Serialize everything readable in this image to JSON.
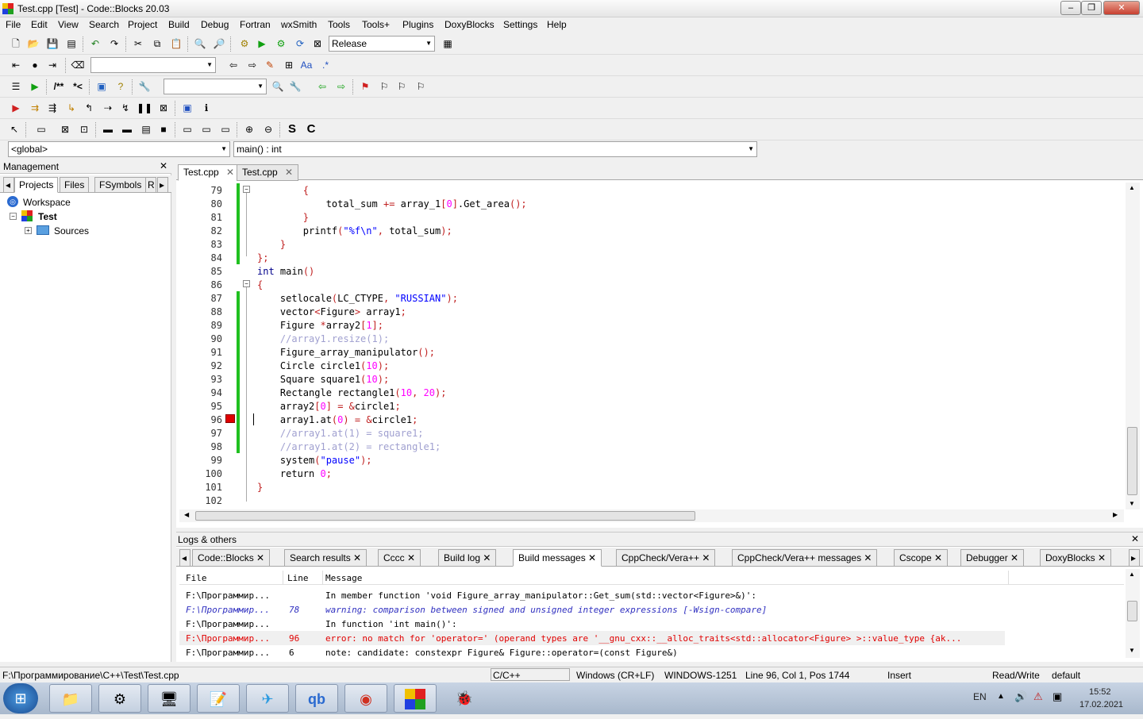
{
  "window": {
    "title": "Test.cpp [Test] - Code::Blocks 20.03"
  },
  "menu": [
    "File",
    "Edit",
    "View",
    "Search",
    "Project",
    "Build",
    "Debug",
    "Fortran",
    "wxSmith",
    "Tools",
    "Tools+",
    "Plugins",
    "DoxyBlocks",
    "Settings",
    "Help"
  ],
  "toolbar": {
    "build_target": "Release"
  },
  "scope": {
    "global": "<global>",
    "function": "main() : int"
  },
  "management": {
    "title": "Management",
    "tabs": [
      "Projects",
      "Files",
      "FSymbols",
      "R"
    ],
    "workspace": "Workspace",
    "project": "Test",
    "folder": "Sources"
  },
  "editor": {
    "tabs": [
      "Test.cpp",
      "Test.cpp"
    ],
    "lines": [
      {
        "n": "79",
        "t": "        {"
      },
      {
        "n": "80",
        "t": "            total_sum += array_1[0].Get_area();"
      },
      {
        "n": "81",
        "t": "        }"
      },
      {
        "n": "82",
        "t": "        printf(\"%f\\n\", total_sum);"
      },
      {
        "n": "83",
        "t": "    }"
      },
      {
        "n": "84",
        "t": "};"
      },
      {
        "n": "85",
        "t": "int main()"
      },
      {
        "n": "86",
        "t": "{"
      },
      {
        "n": "87",
        "t": "    setlocale(LC_CTYPE, \"RUSSIAN\");"
      },
      {
        "n": "88",
        "t": "    vector<Figure> array1;"
      },
      {
        "n": "89",
        "t": "    Figure *array2[1];"
      },
      {
        "n": "90",
        "t": "    //array1.resize(1);"
      },
      {
        "n": "91",
        "t": "    Figure_array_manipulator();"
      },
      {
        "n": "92",
        "t": "    Circle circle1(10);"
      },
      {
        "n": "93",
        "t": "    Square square1(10);"
      },
      {
        "n": "94",
        "t": "    Rectangle rectangle1(10, 20);"
      },
      {
        "n": "95",
        "t": "    array2[0] = &circle1;"
      },
      {
        "n": "96",
        "t": "    array1.at(0) = &circle1;"
      },
      {
        "n": "97",
        "t": "    //array1.at(1) = square1;"
      },
      {
        "n": "98",
        "t": "    //array1.at(2) = rectangle1;"
      },
      {
        "n": "99",
        "t": "    system(\"pause\");"
      },
      {
        "n": "100",
        "t": "    return 0;"
      },
      {
        "n": "101",
        "t": "}"
      },
      {
        "n": "102",
        "t": ""
      }
    ]
  },
  "logs": {
    "title": "Logs & others",
    "tabs": [
      "Code::Blocks",
      "Search results",
      "Cccc",
      "Build log",
      "Build messages",
      "CppCheck/Vera++",
      "CppCheck/Vera++ messages",
      "Cscope",
      "Debugger",
      "DoxyBlocks"
    ],
    "columns": [
      "File",
      "Line",
      "Message"
    ],
    "rows": [
      {
        "file": "F:\\Программир...",
        "line": "",
        "msg": "In member function 'void Figure_array_manipulator::Get_sum(std::vector<Figure>&)':",
        "kind": "normal"
      },
      {
        "file": "F:\\Программир...",
        "line": "78",
        "msg": "warning: comparison between signed and unsigned integer expressions [-Wsign-compare]",
        "kind": "warning"
      },
      {
        "file": "F:\\Программир...",
        "line": "",
        "msg": "In function 'int main()':",
        "kind": "normal"
      },
      {
        "file": "F:\\Программир...",
        "line": "96",
        "msg": "error: no match for 'operator=' (operand types are '__gnu_cxx::__alloc_traits<std::allocator<Figure> >::value_type {ak...",
        "kind": "error"
      },
      {
        "file": "F:\\Программир...",
        "line": "6",
        "msg": "note: candidate: constexpr Figure& Figure::operator=(const Figure&)",
        "kind": "normal"
      }
    ]
  },
  "status": {
    "path": "F:\\Программирование\\C++\\Test\\Test.cpp",
    "lang": "C/C++",
    "eol": "Windows (CR+LF)",
    "enc": "WINDOWS-1251",
    "pos": "Line 96, Col 1, Pos 1744",
    "mode": "Insert",
    "rw": "Read/Write",
    "profile": "default"
  },
  "tray": {
    "lang": "EN",
    "time": "15:52",
    "date": "17.02.2021"
  },
  "colors": {
    "error": "#e00000",
    "warning": "#3030c0",
    "breakpoint": "#e00000",
    "changebar": "#20c020"
  }
}
